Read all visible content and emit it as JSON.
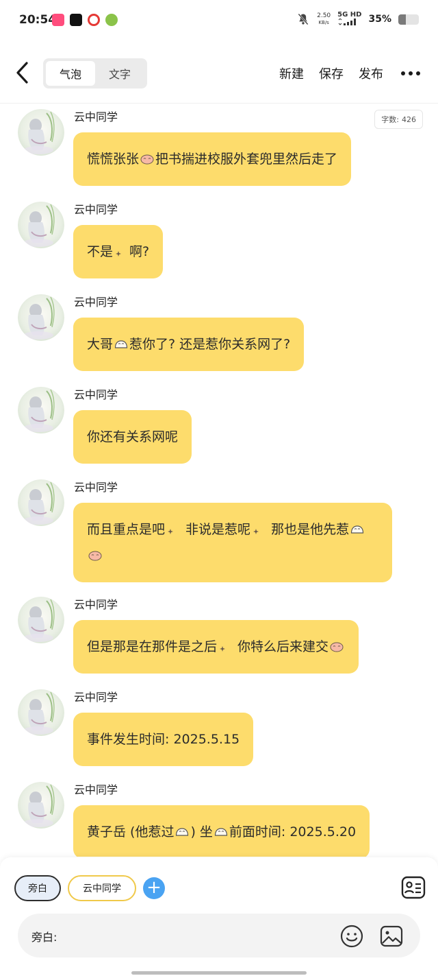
{
  "status_bar": {
    "time": "20:54",
    "speed_value": "2.50",
    "speed_unit": "KB/s",
    "network": "5G HD",
    "battery_percent": "35%",
    "battery_level": 0.35,
    "app_icons": [
      "video-app-icon",
      "capcut-icon",
      "record-app-icon",
      "browser-icon"
    ]
  },
  "header": {
    "tabs": [
      {
        "label": "气泡",
        "active": true
      },
      {
        "label": "文字",
        "active": false
      }
    ],
    "new_label": "新建",
    "save_label": "保存",
    "publish_label": "发布"
  },
  "word_count": {
    "label": "字数:",
    "value": "426"
  },
  "messages": [
    {
      "sender": "云中同学",
      "text": [
        "慌慌张张",
        {
          "emoji": "face"
        },
        "把书揣进校服外套兜里然后走了"
      ]
    },
    {
      "sender": "云中同学",
      "text": [
        "不是",
        {
          "emoji": "sparkle"
        },
        "啊?"
      ]
    },
    {
      "sender": "云中同学",
      "text": [
        "大哥",
        {
          "emoji": "hand"
        },
        "惹你了? 还是惹你关系网了?"
      ]
    },
    {
      "sender": "云中同学",
      "text": [
        "你还有关系网呢"
      ]
    },
    {
      "sender": "云中同学",
      "text": [
        "而且重点是吧",
        {
          "emoji": "sparkle"
        },
        " 非说是惹呢",
        {
          "emoji": "sparkle"
        },
        " 那也是他先惹",
        {
          "emoji": "hand"
        },
        {
          "emoji": "face"
        }
      ]
    },
    {
      "sender": "云中同学",
      "text": [
        "但是那是在那件是之后",
        {
          "emoji": "sparkle"
        },
        " 你特么后来建交",
        {
          "emoji": "face"
        }
      ]
    },
    {
      "sender": "云中同学",
      "text": [
        "事件发生时间: 2025.5.15"
      ]
    },
    {
      "sender": "云中同学",
      "text": [
        "黄子岳 (他惹过",
        {
          "emoji": "hand"
        },
        ") 坐",
        {
          "emoji": "hand"
        },
        "前面时间: 2025.5.20"
      ]
    }
  ],
  "bottom": {
    "narrator_chip": "旁白",
    "character_chip": "云中同学",
    "input_label": "旁白:"
  },
  "colors": {
    "bubble": "#fddc6c",
    "accent_blue": "#4aa3f2",
    "chip_border_gold": "#f0c94a"
  }
}
